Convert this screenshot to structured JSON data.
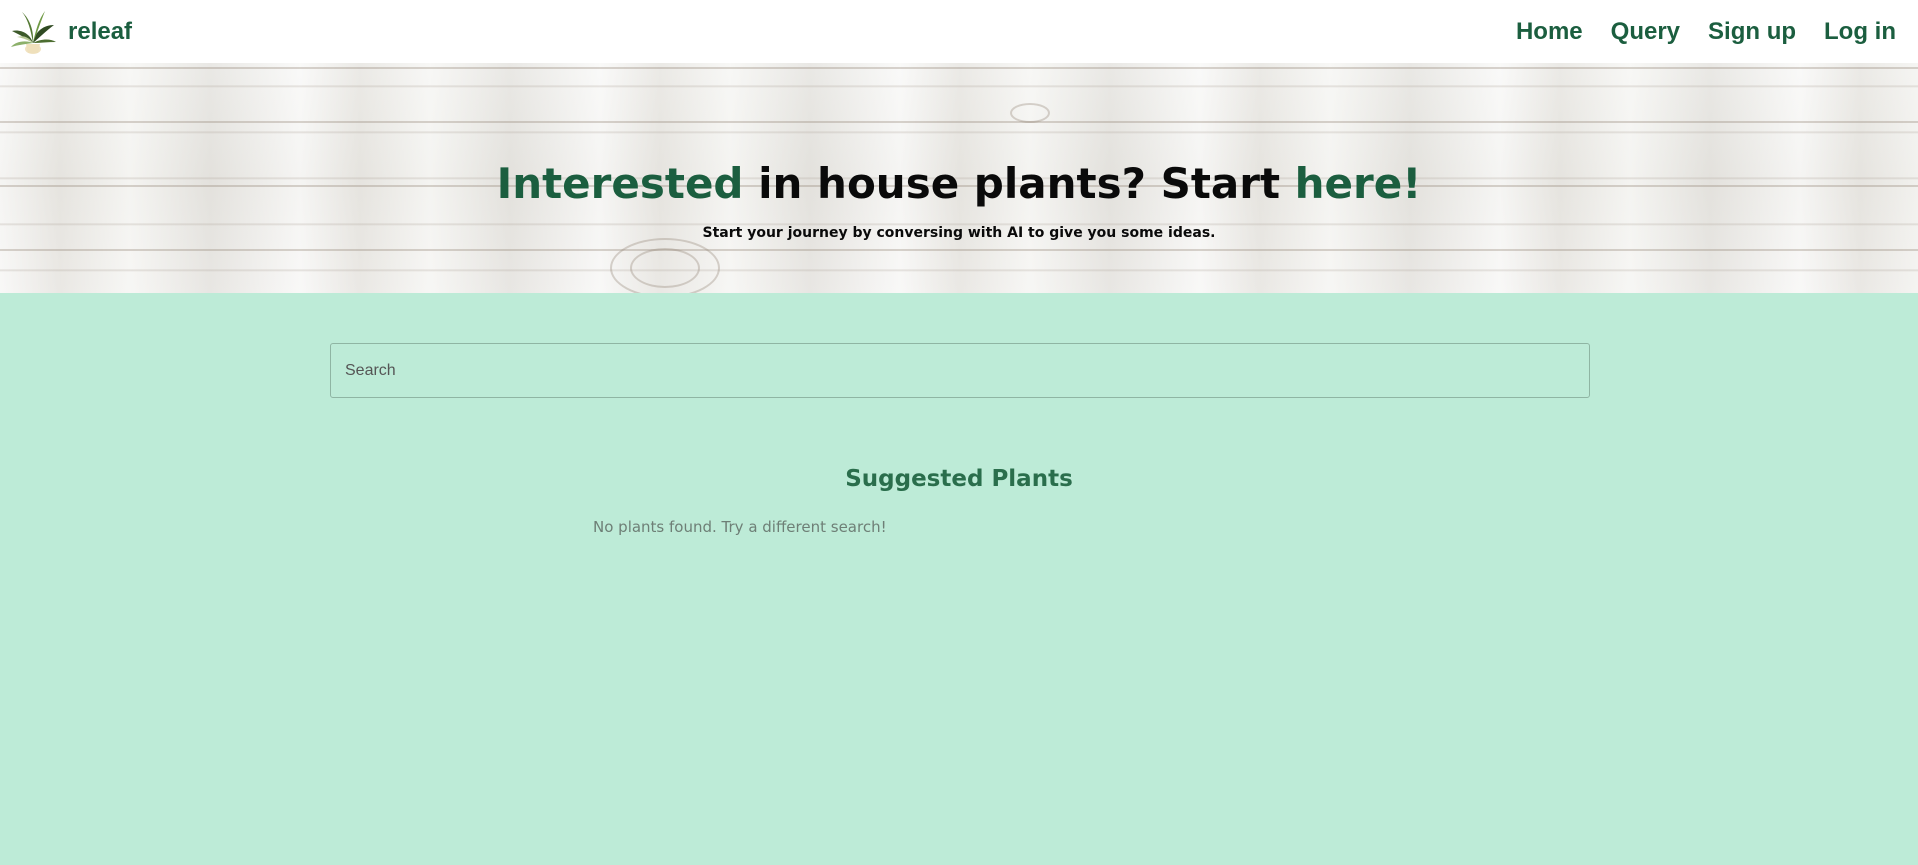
{
  "navbar": {
    "brand_name": "releaf",
    "links": [
      {
        "label": "Home"
      },
      {
        "label": "Query"
      },
      {
        "label": "Sign up"
      },
      {
        "label": "Log in"
      }
    ]
  },
  "hero": {
    "title_part1": "Interested",
    "title_part2": " in house plants? Start ",
    "title_part3": "here!",
    "subtitle": "Start your journey by conversing with AI to give you some ideas."
  },
  "search": {
    "placeholder": "Search",
    "value": ""
  },
  "suggested": {
    "title": "Suggested Plants",
    "empty_message": "No plants found. Try a different search!"
  },
  "colors": {
    "brand": "#1b5e3f",
    "accent": "#2a6e4c",
    "background": "#bdebd7"
  },
  "icons": {
    "logo": "potted-plant-icon"
  }
}
